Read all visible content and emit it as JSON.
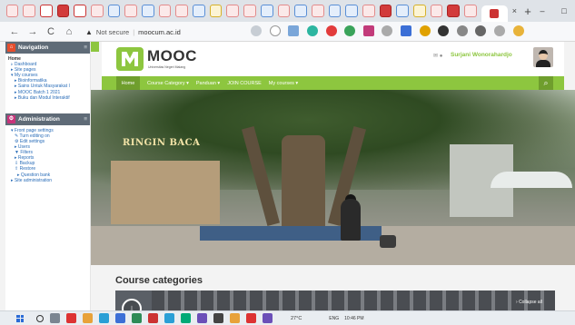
{
  "browser": {
    "tab_close": "×",
    "new_tab": "+",
    "window_controls": {
      "minimize": "–",
      "maximize": "□"
    },
    "back": "←",
    "forward": "→",
    "reload": "C",
    "home": "⌂",
    "security_text": "Not secure",
    "url": "moocum.ac.id"
  },
  "sidebar": {
    "navigation": {
      "title": "Navigation",
      "items": [
        {
          "label": "Home",
          "level": 0
        },
        {
          "label": "Dashboard",
          "level": 1
        },
        {
          "label": "Site pages",
          "level": 1
        },
        {
          "label": "My courses",
          "level": 1
        },
        {
          "label": "Bioinformatika",
          "level": 2
        },
        {
          "label": "Sains Untuk Masyarakat I",
          "level": 2
        },
        {
          "label": "MOOC Batch 1 2021",
          "level": 2
        },
        {
          "label": "Buku dan Modul Interaktif",
          "level": 2
        }
      ]
    },
    "administration": {
      "title": "Administration",
      "items": [
        {
          "label": "Front page settings",
          "level": 1
        },
        {
          "label": "Turn editing on",
          "level": 2
        },
        {
          "label": "Edit settings",
          "level": 2
        },
        {
          "label": "Users",
          "level": 2
        },
        {
          "label": "Filters",
          "level": 2
        },
        {
          "label": "Reports",
          "level": 2
        },
        {
          "label": "Backup",
          "level": 2
        },
        {
          "label": "Restore",
          "level": 2
        },
        {
          "label": "Question bank",
          "level": 3
        },
        {
          "label": "Site administration",
          "level": 1
        }
      ]
    }
  },
  "header": {
    "logo_text": "MOOC",
    "logo_subtitle": "Universitas Negeri Malang",
    "user_name": "Surjani Wonorahardjo"
  },
  "nav": {
    "home": "Home",
    "items": [
      "Course Category ▾",
      "Panduan ▾",
      "JOIN COURSE",
      "My courses ▾"
    ]
  },
  "hero": {
    "caption": "RINGIN BACA"
  },
  "main": {
    "course_categories_title": "Course categories",
    "collapse_all": "Collapse all"
  },
  "taskbar": {
    "weather": "27°C",
    "language": "ENG",
    "time": "10:46 PM"
  },
  "colors": {
    "accent_green": "#8dc63f",
    "sidebar_header": "#5f6b77",
    "link_blue": "#2a6db8"
  }
}
